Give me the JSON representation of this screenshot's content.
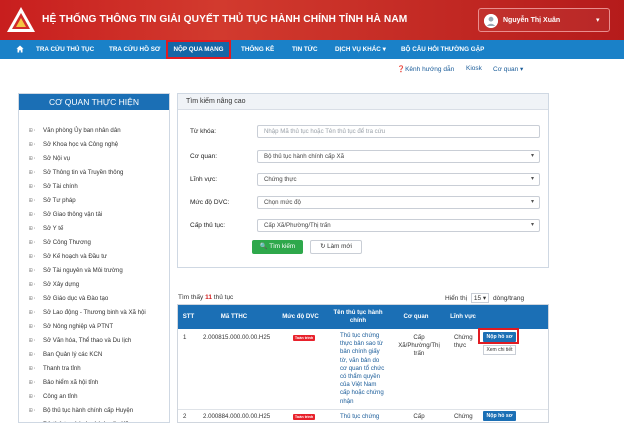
{
  "header": {
    "title": "HỆ THỐNG THÔNG TIN GIẢI QUYẾT THỦ TỤC HÀNH CHÍNH TỈNH HÀ NAM",
    "user_name": "Nguyễn Thị Xuân",
    "brand_color": "#c81e1e"
  },
  "nav": {
    "home_icon": "home-icon",
    "items": [
      {
        "label": "TRA CỨU THỦ TỤC"
      },
      {
        "label": "TRA CỨU HỒ SƠ"
      },
      {
        "label": "NỘP QUA MẠNG"
      },
      {
        "label": "THỐNG KÊ"
      },
      {
        "label": "TIN TỨC"
      },
      {
        "label": "DỊCH VỤ KHÁC"
      },
      {
        "label": "BỘ CÂU HỎI THƯỜNG GẶP"
      }
    ],
    "active_index": 2
  },
  "sublinks": {
    "guide": "Kênh hướng dẫn",
    "kiosk": "Kiosk",
    "agency": "Cơ quan"
  },
  "left_panel": {
    "title": "CƠ QUAN THỰC HIỆN",
    "items": [
      "Văn phòng Ủy ban nhân dân",
      "Sở Khoa học và Công nghệ",
      "Sở Nội vụ",
      "Sở Thông tin và Truyền thông",
      "Sở Tài chính",
      "Sở Tư pháp",
      "Sở Giao thông vận tải",
      "Sở Y tế",
      "Sở Công Thương",
      "Sở Kế hoạch và Đầu tư",
      "Sở Tài nguyên và Môi trường",
      "Sở Xây dựng",
      "Sở Giáo dục và Đào tạo",
      "Sở Lao động - Thương binh và Xã hội",
      "Sở Nông nghiệp và PTNT",
      "Sở Văn hóa, Thể thao và Du lịch",
      "Ban Quản lý các KCN",
      "Thanh tra tỉnh",
      "Bảo hiểm xã hội tỉnh",
      "Công an tỉnh",
      "Bộ thủ tục hành chính cấp Huyện",
      "Bộ thủ tục hành chính cấp Xã"
    ]
  },
  "search": {
    "title": "Tìm kiếm nâng cao",
    "keyword_label": "Từ khóa:",
    "keyword_placeholder": "Nhập Mã thủ tục hoặc Tên thủ tục để tra cứu",
    "agency_label": "Cơ quan:",
    "agency_value": "Bộ thủ tục hành chính cấp Xã",
    "field_label": "Lĩnh vực:",
    "field_value": "Chứng thực",
    "level_label": "Mức độ DVC:",
    "level_value": "Chọn mức độ",
    "tier_label": "Cấp thủ tục:",
    "tier_value": "Cấp Xã/Phường/Thị trấn",
    "search_button": "Tìm kiếm",
    "reset_button": "Làm mới",
    "search_color": "#2ea84b"
  },
  "results": {
    "found_prefix": "Tìm thấy",
    "found_count": "11",
    "found_suffix": "thủ tục",
    "pagesize_prefix": "Hiển thị",
    "pagesize_value": "15",
    "pagesize_suffix": "dòng/trang",
    "columns": [
      "STT",
      "Mã TTHC",
      "Mức độ DVC",
      "Tên thủ tục hành chính",
      "Cơ quan",
      "Lĩnh vực",
      ""
    ],
    "rows": [
      {
        "stt": "1",
        "code": "2.000815.000.00.00.H25",
        "level_badge": "Toàn trình",
        "name": "Thủ tục chứng thực bản sao từ bản chính giấy tờ, văn bản do cơ quan tổ chức có thẩm quyền của Việt Nam cấp hoặc chứng nhận",
        "agency": "Cấp Xã/Phường/Thị trấn",
        "field": "Chứng thực",
        "submit": "Nộp hồ sơ",
        "view": "Xem chi tiết"
      },
      {
        "stt": "2",
        "code": "2.000884.000.00.00.H25",
        "level_badge": "Toàn trình",
        "name": "Thủ tục chứng",
        "agency": "Cấp",
        "field": "Chứng",
        "submit": "Nộp hồ sơ"
      }
    ]
  }
}
